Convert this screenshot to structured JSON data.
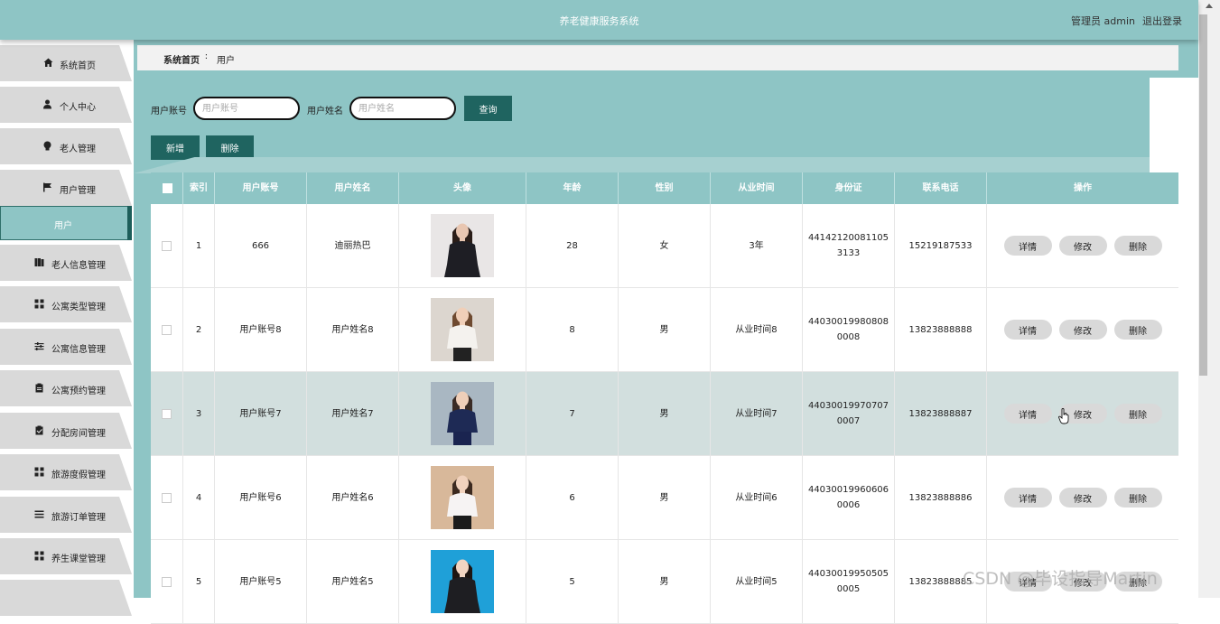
{
  "header": {
    "title": "养老健康服务系统",
    "admin": "管理员 admin",
    "logout": "退出登录"
  },
  "sidebar": {
    "items": [
      {
        "label": "系统首页",
        "icon": "home-icon"
      },
      {
        "label": "个人中心",
        "icon": "user-icon"
      },
      {
        "label": "老人管理",
        "icon": "bulb-icon"
      },
      {
        "label": "用户管理",
        "icon": "flag-icon"
      },
      {
        "label": "老人信息管理",
        "icon": "book-icon"
      },
      {
        "label": "公寓类型管理",
        "icon": "grid-icon"
      },
      {
        "label": "公寓信息管理",
        "icon": "sliders-icon"
      },
      {
        "label": "公寓预约管理",
        "icon": "clipboard-icon"
      },
      {
        "label": "分配房间管理",
        "icon": "clipboard-check-icon"
      },
      {
        "label": "旅游度假管理",
        "icon": "grid-icon"
      },
      {
        "label": "旅游订单管理",
        "icon": "list-icon"
      },
      {
        "label": "养生课堂管理",
        "icon": "grid-icon"
      }
    ],
    "active_sub": "用户"
  },
  "breadcrumb": {
    "home": "系统首页",
    "sep": "∶",
    "current": "用户"
  },
  "search": {
    "account_label": "用户账号",
    "account_placeholder": "用户账号",
    "name_label": "用户姓名",
    "name_placeholder": "用户姓名",
    "query_btn": "查询"
  },
  "actions": {
    "add": "新增",
    "delete": "删除"
  },
  "table": {
    "headers": [
      "索引",
      "用户账号",
      "用户姓名",
      "头像",
      "年龄",
      "性别",
      "从业时间",
      "身份证",
      "联系电话",
      "操作"
    ],
    "rows": [
      {
        "idx": "1",
        "account": "666",
        "name": "迪丽热巴",
        "age": "28",
        "gender": "女",
        "years": "3年",
        "idcard": "441421200811053133",
        "phone": "15219187533"
      },
      {
        "idx": "2",
        "account": "用户账号8",
        "name": "用户姓名8",
        "age": "8",
        "gender": "男",
        "years": "从业时间8",
        "idcard": "440300199808080008",
        "phone": "13823888888"
      },
      {
        "idx": "3",
        "account": "用户账号7",
        "name": "用户姓名7",
        "age": "7",
        "gender": "男",
        "years": "从业时间7",
        "idcard": "440300199707070007",
        "phone": "13823888887"
      },
      {
        "idx": "4",
        "account": "用户账号6",
        "name": "用户姓名6",
        "age": "6",
        "gender": "男",
        "years": "从业时间6",
        "idcard": "440300199606060006",
        "phone": "13823888886"
      },
      {
        "idx": "5",
        "account": "用户账号5",
        "name": "用户姓名5",
        "age": "5",
        "gender": "男",
        "years": "从业时间5",
        "idcard": "440300199505050005",
        "phone": "13823888885"
      }
    ],
    "op_detail": "详情",
    "op_edit": "修改",
    "op_delete": "删除"
  },
  "watermark": "CSDN @毕设指导Martin",
  "colors": {
    "teal": "#8ec5c5",
    "dark_teal": "#1f6460",
    "highlight_row": "#d2dfde"
  }
}
